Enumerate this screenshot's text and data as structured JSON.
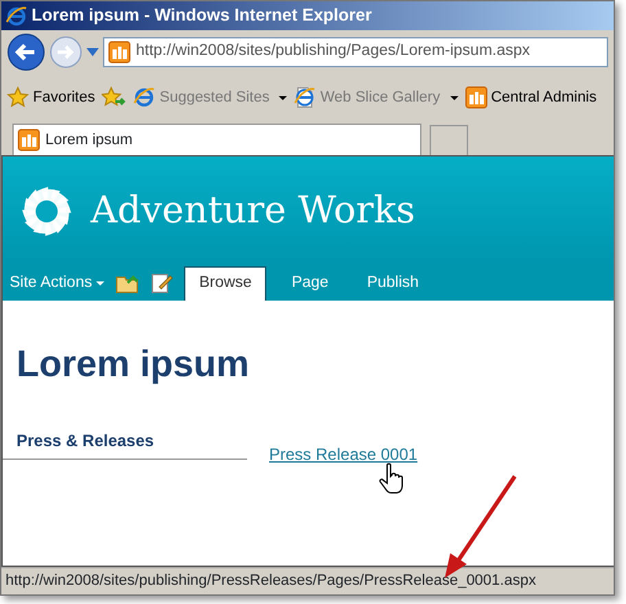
{
  "window": {
    "title": "Lorem ipsum - Windows Internet Explorer"
  },
  "address_bar": {
    "url": "http://win2008/sites/publishing/Pages/Lorem-ipsum.aspx"
  },
  "favorites_bar": {
    "label": "Favorites",
    "links": [
      {
        "label": "Suggested Sites",
        "kind": "ie",
        "has_menu": true
      },
      {
        "label": "Web Slice Gallery",
        "kind": "page",
        "has_menu": true
      },
      {
        "label": "Central Adminis",
        "kind": "site",
        "has_menu": false
      }
    ]
  },
  "browser_tabs": [
    {
      "label": "Lorem ipsum",
      "selected": true
    }
  ],
  "site": {
    "title": "Adventure Works",
    "site_actions": "Site Actions",
    "ribbon_tabs": [
      {
        "label": "Browse",
        "selected": true
      },
      {
        "label": "Page",
        "selected": false
      },
      {
        "label": "Publish",
        "selected": false
      }
    ]
  },
  "page": {
    "heading": "Lorem ipsum",
    "section_title": "Press & Releases",
    "link": "Press Release 0001"
  },
  "status_bar": {
    "text": "http://win2008/sites/publishing/PressReleases/Pages/PressRelease_0001.aspx"
  }
}
